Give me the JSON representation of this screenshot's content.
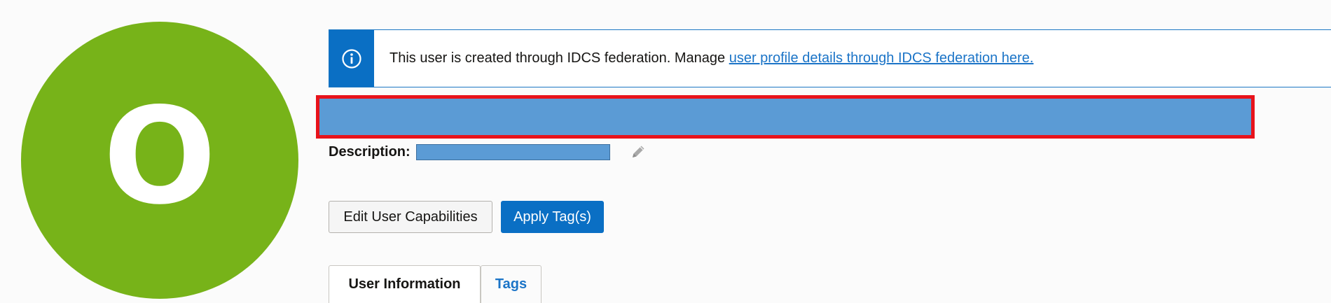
{
  "avatar": {
    "initial": "O",
    "color": "#77b319"
  },
  "banner": {
    "icon": "info-icon",
    "text": "This user is created through IDCS federation. Manage ",
    "link_text": "user profile details through IDCS federation here."
  },
  "user_name": {
    "value": ""
  },
  "description": {
    "label": "Description:",
    "value": "",
    "edit_icon": "pencil-icon"
  },
  "actions": {
    "edit_capabilities_label": "Edit User Capabilities",
    "apply_tags_label": "Apply Tag(s)"
  },
  "tabs": [
    {
      "label": "User Information",
      "active": true
    },
    {
      "label": "Tags",
      "active": false
    }
  ],
  "colors": {
    "accent": "#0a6fc4",
    "link": "#1b74c7",
    "highlight_border": "#e8131b",
    "redaction": "#5b9bd5"
  }
}
